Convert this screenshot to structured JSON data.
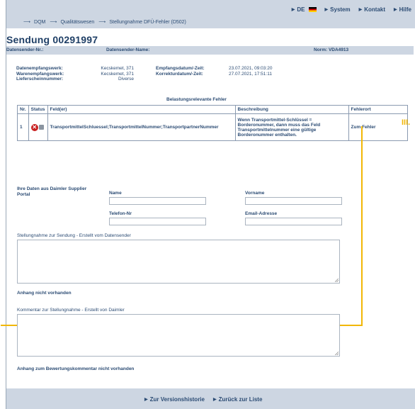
{
  "topnav": [
    {
      "label": "DE"
    },
    {
      "label": "System"
    },
    {
      "label": "Kontakt"
    },
    {
      "label": "Hilfe"
    }
  ],
  "breadcrumb": [
    "DQM",
    "Qualitätswesen",
    "Stellungnahme DFÜ-Fehler (D502)"
  ],
  "page_title": "Sendung 00291997",
  "infobar": {
    "sender_nr_label": "Datensender-Nr.:",
    "sender_name_label": "Datensender-Name:",
    "norm": "Norm: VDA4913"
  },
  "details": {
    "datenempfangswerk_label": "Datenempfangswerk:",
    "warenempfangswerk_label": "Warenempfangswerk:",
    "lieferschein_label": "Lieferscheinnummer:",
    "datenempfangswerk": "Kecskemet, 371",
    "warenempfangswerk": "Kecskemet, 371",
    "lieferschein": "Diverse",
    "empfang_label": "Empfangsdatum/-Zeit:",
    "korrektur_label": "Korrekturdatum/-Zeit:",
    "empfang": "23.07.2021, 09:03:20",
    "korrektur": "27.07.2021, 17:51:11"
  },
  "table": {
    "title": "Belastungsrelevante Fehler",
    "headers": [
      "Nr.",
      "Status",
      "Feld(er)",
      "Beschreibung",
      "Fehlerort"
    ],
    "rows": [
      {
        "nr": "1",
        "felder": "TransportmittelSchluessel;TransportmittelNummer;TransportpartnerNummer",
        "beschreibung": "Wenn Transportmittel-Schlüssel = Borderonummer, dann muss das Feld Transportmittelnummer eine gültige Borderonummer enthalten.",
        "fehlerort": "Zum Fehler"
      }
    ]
  },
  "annotation": {
    "step": "III.",
    "color": "#f2b705"
  },
  "supplier": {
    "heading": "Ihre Daten aus Daimler Supplier Portal",
    "name_label": "Name",
    "vorname_label": "Vorname",
    "telefon_label": "Telefon-Nr",
    "email_label": "Email-Adresse"
  },
  "sections": {
    "stellungnahme_label": "Stellungnahme zur Sendung - Erstellt vom Datensender",
    "anhang_label": "Anhang nicht vorhanden",
    "kommentar_label": "Kommentar zur Stellungnahme - Erstellt von Daimler",
    "anhang_bewertung_label": "Anhang zum Bewertungskommentar nicht vorhanden"
  },
  "bottomnav": [
    {
      "label": "Zur Versionshistorie"
    },
    {
      "label": "Zurück zur Liste"
    }
  ]
}
